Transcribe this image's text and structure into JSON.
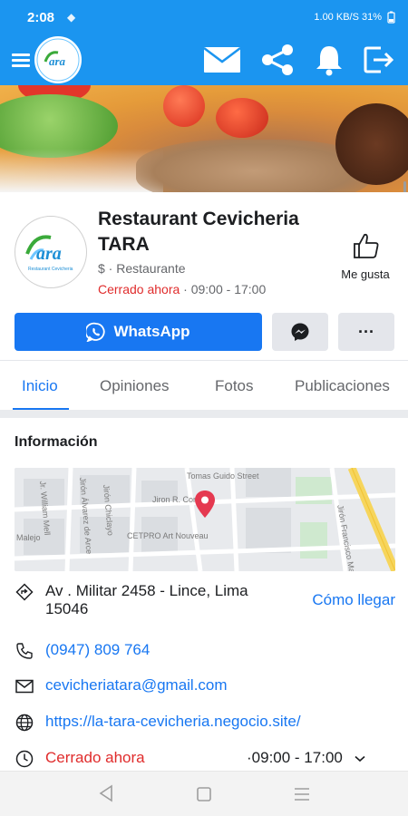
{
  "status_bar": {
    "time": "2:08",
    "right_text": "1.00 KB/S  31%"
  },
  "app_bar": {
    "logo_text": "ara",
    "icons": [
      "menu-icon",
      "mail-icon",
      "share-icon",
      "bell-icon",
      "logout-icon"
    ]
  },
  "profile": {
    "name": "Restaurant Cevicheria TARA",
    "category": "$ · Restaurante",
    "status_closed": "Cerrado ahora",
    "status_hours": " · 09:00 - 17:00",
    "like_label": "Me gusta",
    "logo_text": "ara",
    "logo_subtext": "Restaurant Cevicheria"
  },
  "actions": {
    "whatsapp_label": "WhatsApp",
    "more_label": "···"
  },
  "tabs": [
    {
      "label": "Inicio",
      "active": true
    },
    {
      "label": "Opiniones",
      "active": false
    },
    {
      "label": "Fotos",
      "active": false
    },
    {
      "label": "Publicaciones",
      "active": false
    }
  ],
  "info": {
    "title": "Información",
    "map_labels": [
      "Tomas Guido Street",
      "Jiron R. Conde",
      "CETPRO Art Nouveau",
      "Jirón Francisco Ma",
      "Jirón Chiclayo",
      "Jirón Álvarez de Arce",
      "Jr. William Mell",
      "Malejo"
    ],
    "address": "Av . Militar 2458 - Lince, Lima 15046",
    "directions_label": "Cómo llegar",
    "phone": "(0947) 809 764",
    "email": "cevicheriatara@gmail.com",
    "website": "https://la-tara-cevicheria.negocio.site/",
    "hours_status": "Cerrado ahora",
    "hours_range": "·09:00 - 17:00"
  },
  "colors": {
    "brand_blue": "#1b95f0",
    "facebook_blue": "#1877f2",
    "closed_red": "#e02c2c",
    "map_pin": "#e53950"
  }
}
